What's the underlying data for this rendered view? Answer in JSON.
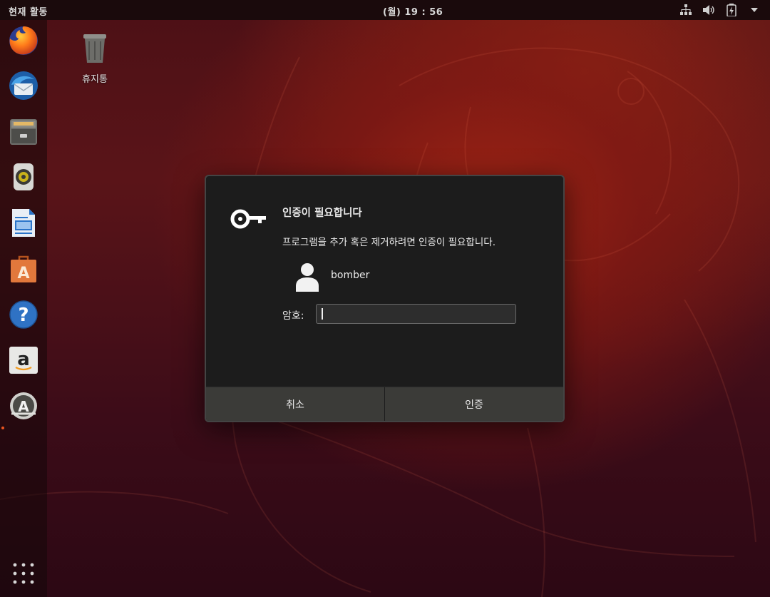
{
  "topbar": {
    "activities_label": "현재 활동",
    "clock": "(월) 19 : 56",
    "tray_icons": [
      "network-icon",
      "volume-icon",
      "battery-icon",
      "system-menu-arrow-icon"
    ]
  },
  "dock": {
    "items": [
      {
        "name": "firefox",
        "icon": "firefox-icon"
      },
      {
        "name": "thunderbird",
        "icon": "thunderbird-icon"
      },
      {
        "name": "files",
        "icon": "files-icon"
      },
      {
        "name": "rhythmbox",
        "icon": "rhythmbox-icon"
      },
      {
        "name": "libreoffice-writer",
        "icon": "writer-icon"
      },
      {
        "name": "software",
        "icon": "software-bag-icon"
      },
      {
        "name": "help",
        "icon": "help-icon"
      },
      {
        "name": "amazon",
        "icon": "amazon-icon"
      },
      {
        "name": "software-updater",
        "icon": "software-updater-icon"
      }
    ],
    "show_apps_icon": "apps-grid-icon"
  },
  "desktop": {
    "trash_label": "휴지통"
  },
  "dialog": {
    "title": "인증이 필요합니다",
    "message": "프로그램을 추가 혹은 제거하려면 인증이 필요합니다.",
    "user": "bomber",
    "password_label": "암호:",
    "password_value": "",
    "cancel_label": "취소",
    "authenticate_label": "인증"
  },
  "colors": {
    "accent": "#e95420",
    "dialog_bg": "#1c1c1c",
    "button_bar": "#3b3b38"
  }
}
